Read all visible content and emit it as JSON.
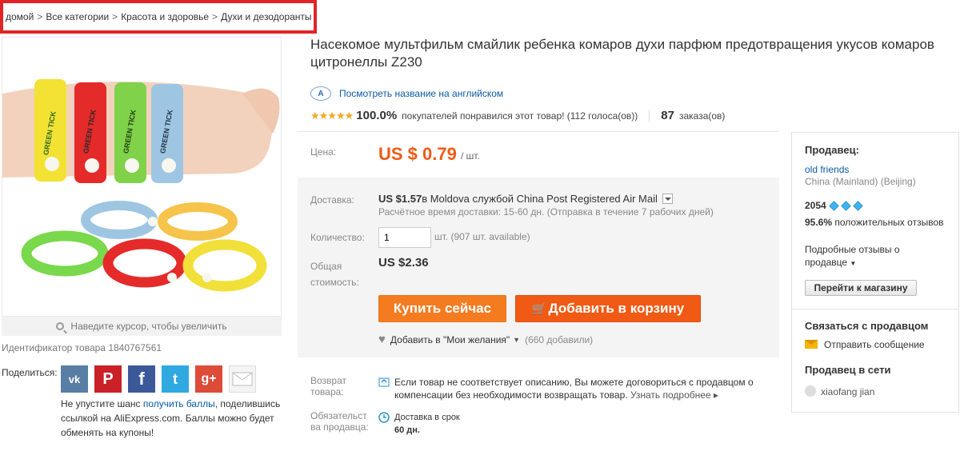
{
  "breadcrumb": {
    "items": [
      "домой",
      "Все категории",
      "Красота и здоровье",
      "Духи и дезодоранты"
    ],
    "separator": ">"
  },
  "gallery": {
    "zoom_hint": "Наведите курсор, чтобы увеличить",
    "product_id_label": "Идентификатор товара",
    "product_id": "1840767561",
    "band_text": "GREEN TICK"
  },
  "share": {
    "label": "Поделиться:",
    "icons": [
      "vk-icon",
      "pinterest-icon",
      "facebook-icon",
      "twitter-icon",
      "google-plus-icon",
      "mail-icon"
    ],
    "vk_glyph": "vk",
    "pin_glyph": "P",
    "fb_glyph": "f",
    "tw_glyph": "t",
    "gp_glyph": "g+",
    "note_before": "Не упустите шанс ",
    "note_link": "получить баллы",
    "note_after": ", поделившись ссылкой на AliExpress.com. Баллы можно будет обменять на купоны!"
  },
  "product": {
    "title": "Насекомое мультфильм смайлик ребенка комаров духи парфюм предотвращения укусов комаров цитронеллы Z230",
    "translate_icon": "A",
    "translate_link": "Посмотреть название на английском",
    "stars": "★★★★★",
    "rating_percent": "100.0%",
    "rating_text": "покупателей понравился этот товар! (112 голоса(ов))",
    "orders_count": "87",
    "orders_label": "заказа(ов)"
  },
  "price": {
    "label": "Цена:",
    "value": "US $ 0.79",
    "unit": "/ шт."
  },
  "shipping": {
    "label": "Доставка:",
    "cost": "US $1.57",
    "desc": " в Moldova службой China Post Registered Air Mail",
    "time": "Расчётное время доставки: 15-60 дн. (Отправка в течение 7 рабочих дней)"
  },
  "quantity": {
    "label": "Количество:",
    "value": "1",
    "note": "шт. (907 шт. available)"
  },
  "total": {
    "label_line1": "Общая",
    "label_line2": "стоимость:",
    "value": "US $2.36"
  },
  "actions": {
    "buy_now": "Купить сейчас",
    "add_to_cart": "Добавить в корзину",
    "cart_glyph": "🛒",
    "wishlist": "Добавить в \"Мои желания\"",
    "wishlist_count": "(660 добавили)"
  },
  "guarantees": {
    "return_label_1": "Возврат",
    "return_label_2": "товара:",
    "return_text": "Если товар не соответствует описанию, Вы можете договориться с продавцом о компенсации без необходимости возвращать товар.",
    "return_more": "Узнать подробнее ▸",
    "seller_label_1": "Обязательст",
    "seller_label_2": "ва продавца:",
    "delivery_text": "Доставка в срок",
    "delivery_days": "60 дн."
  },
  "seller": {
    "heading": "Продавец:",
    "name": "old friends",
    "location": "China (Mainland) (Beijing)",
    "score": "2054",
    "positive_pct": "95.6%",
    "positive_text": "положительных отзывов",
    "detail_link": "Подробные отзывы о продавце",
    "store_button": "Перейти к магазину",
    "contact_heading": "Связаться с продавцом",
    "send_message": "Отправить сообщение",
    "online_heading": "Продавец в сети",
    "online_user": "xiaofang jian"
  },
  "colors": {
    "accent_orange": "#f05a14",
    "buy_orange": "#f47b20",
    "link_blue": "#0b5aa5",
    "highlight_red": "#e02428",
    "star_gold": "#f5a623"
  }
}
